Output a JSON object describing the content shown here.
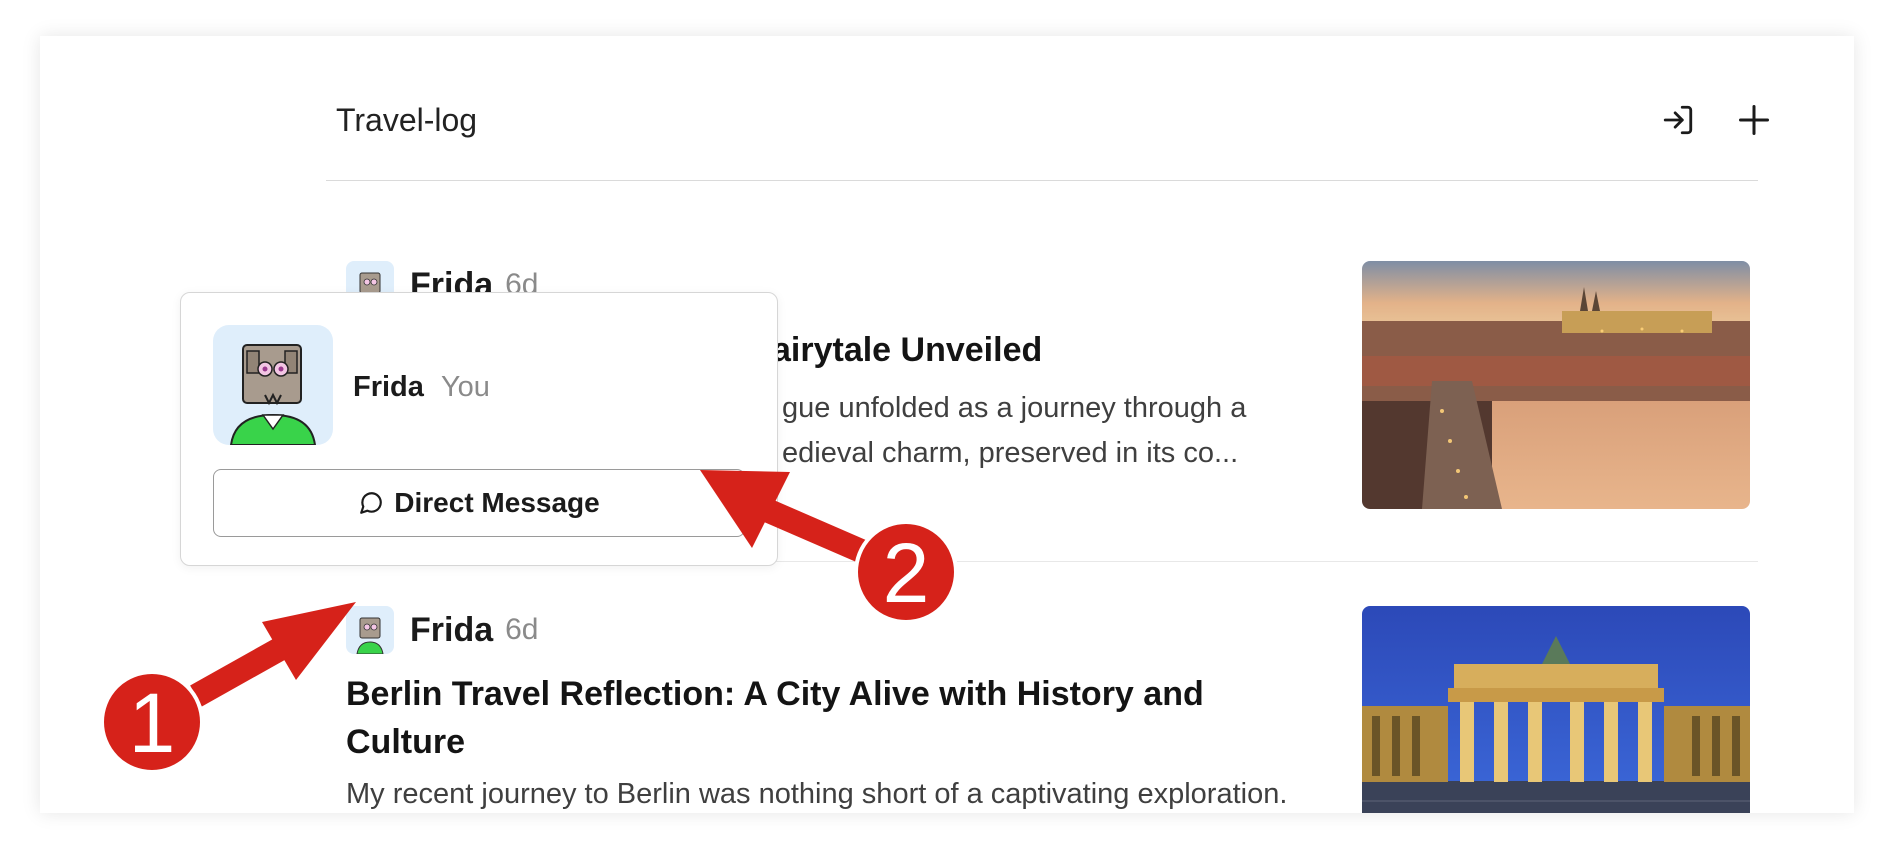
{
  "header": {
    "title": "Travel-log",
    "login_icon": "login-icon",
    "add_icon": "plus-icon"
  },
  "posts": [
    {
      "author": "Frida",
      "age": "6d",
      "title_visible": "airytale Unveiled",
      "excerpt_line1": "gue unfolded as a journey through a",
      "excerpt_line2": "edieval charm, preserved in its co...",
      "image": "Prague skyline at dusk with castle and Charles Bridge"
    },
    {
      "author": "Frida",
      "age": "6d",
      "title": "Berlin Travel Reflection: A City Alive with History and Culture",
      "excerpt": "My recent journey to Berlin was nothing short of a captivating exploration. The remnants of the Berlin Wall stood as silent wit",
      "image": "Brandenburg Gate illuminated at night"
    }
  ],
  "popover": {
    "name": "Frida",
    "you_label": "You",
    "button_label": "Direct Message",
    "button_icon": "chat-bubble-icon"
  },
  "annotations": {
    "step1": "1",
    "step2": "2",
    "color": "#d6221a"
  }
}
